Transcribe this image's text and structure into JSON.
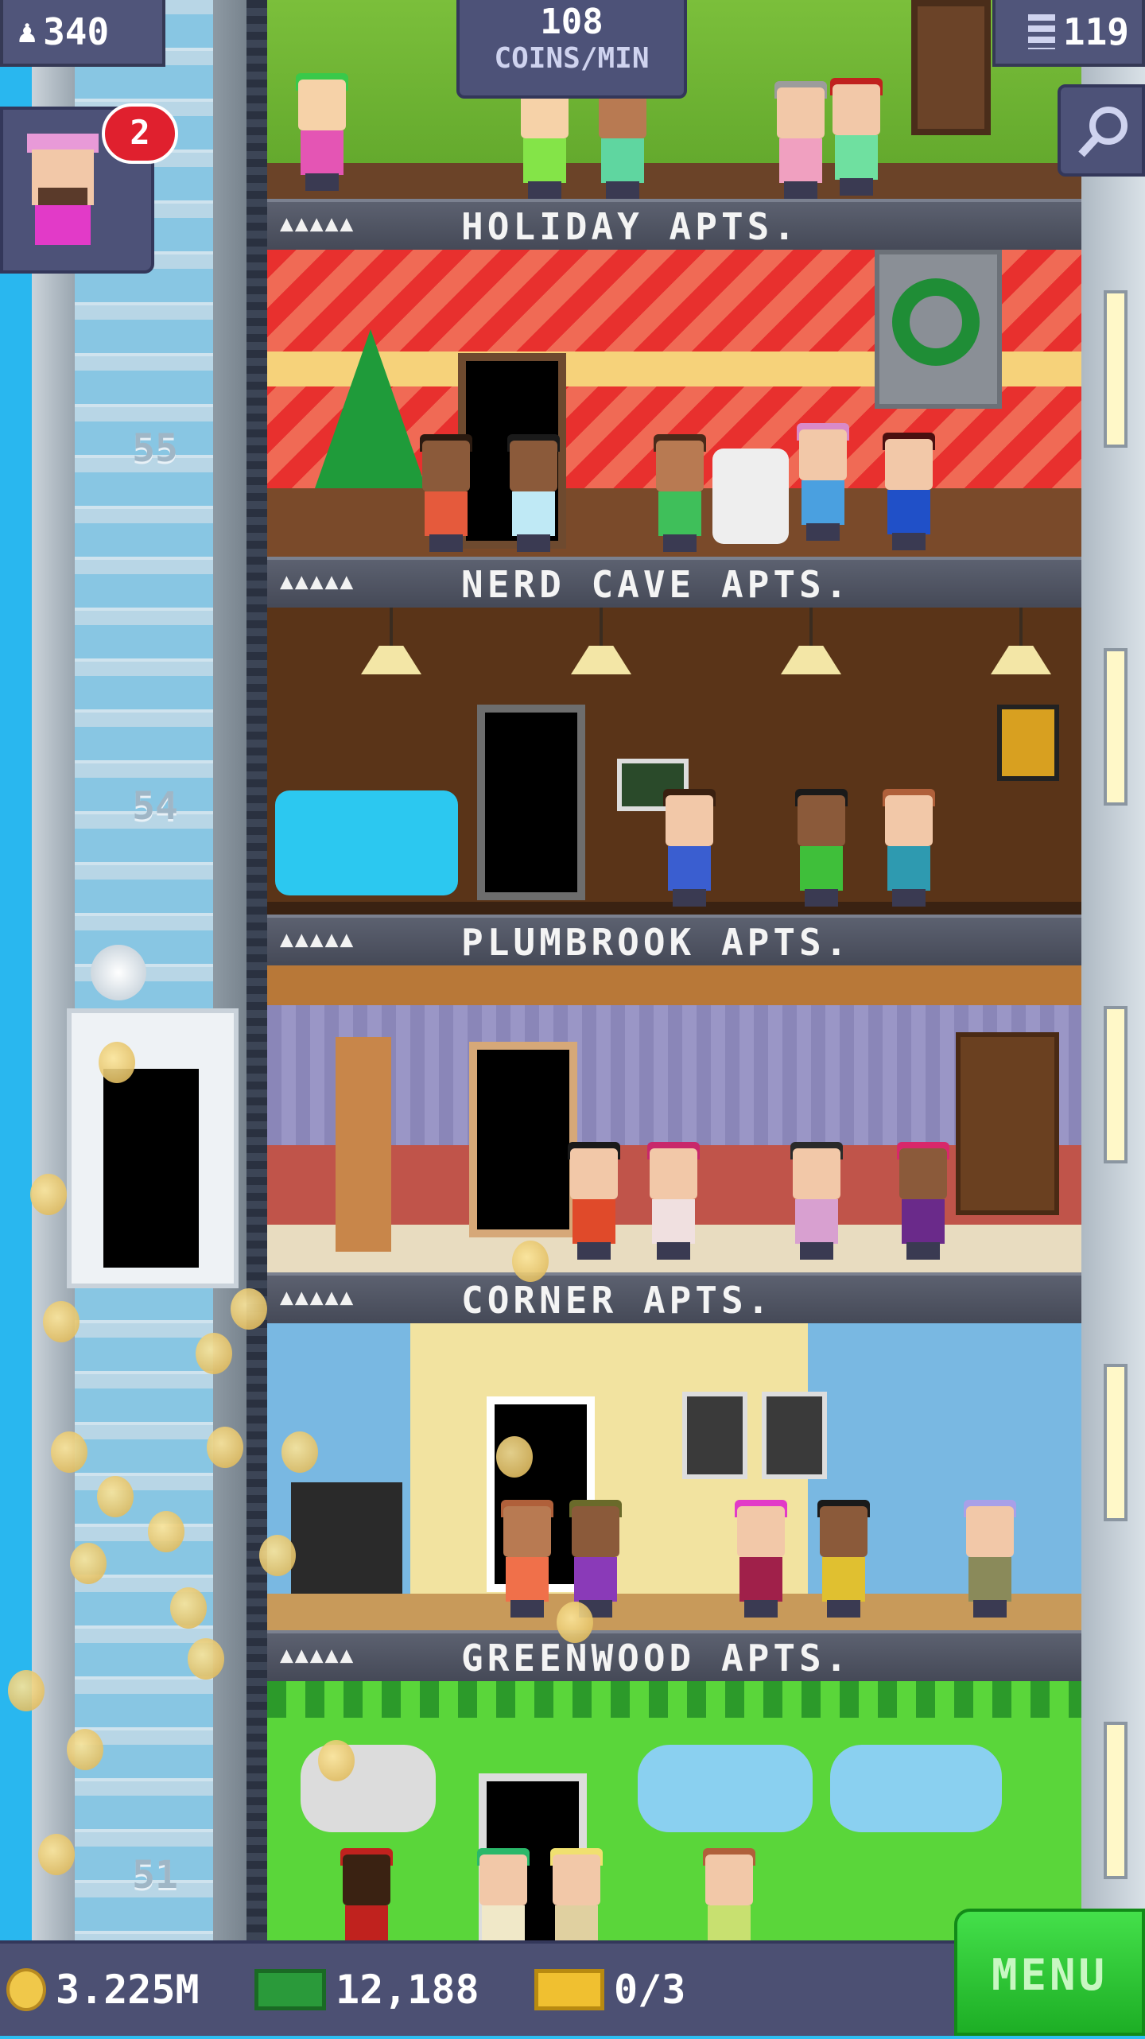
{
  "hud_top": {
    "population": "340",
    "coins_per_min_value": "108",
    "coins_per_min_unit": "COINS/MIN",
    "floors": "119",
    "visitor_count": "2"
  },
  "floors": [
    {
      "name": "HOLIDAY APTS.",
      "dots": "▲▲▲▲▲"
    },
    {
      "name": "NERD CAVE APTS.",
      "dots": "▲▲▲▲▲"
    },
    {
      "name": "PLUMBROOK APTS.",
      "dots": "▲▲▲▲▲"
    },
    {
      "name": "CORNER APTS.",
      "dots": "▲▲▲▲▲"
    },
    {
      "name": "GREENWOOD APTS.",
      "dots": "▲▲▲▲▲"
    }
  ],
  "elevator_floor_numbers": [
    "55",
    "54",
    "51"
  ],
  "hud_bottom": {
    "coins": "3.225M",
    "bux": "12,188",
    "tickets": "0/3",
    "menu_label": "MENU"
  },
  "colors": {
    "menu_green": "#2cc735",
    "hud_purple": "#4d5278",
    "badge_red": "#e0202e"
  },
  "icons": [
    "person-icon",
    "building-icon",
    "magnifier-icon",
    "coin-icon",
    "bux-icon",
    "ticket-icon"
  ]
}
